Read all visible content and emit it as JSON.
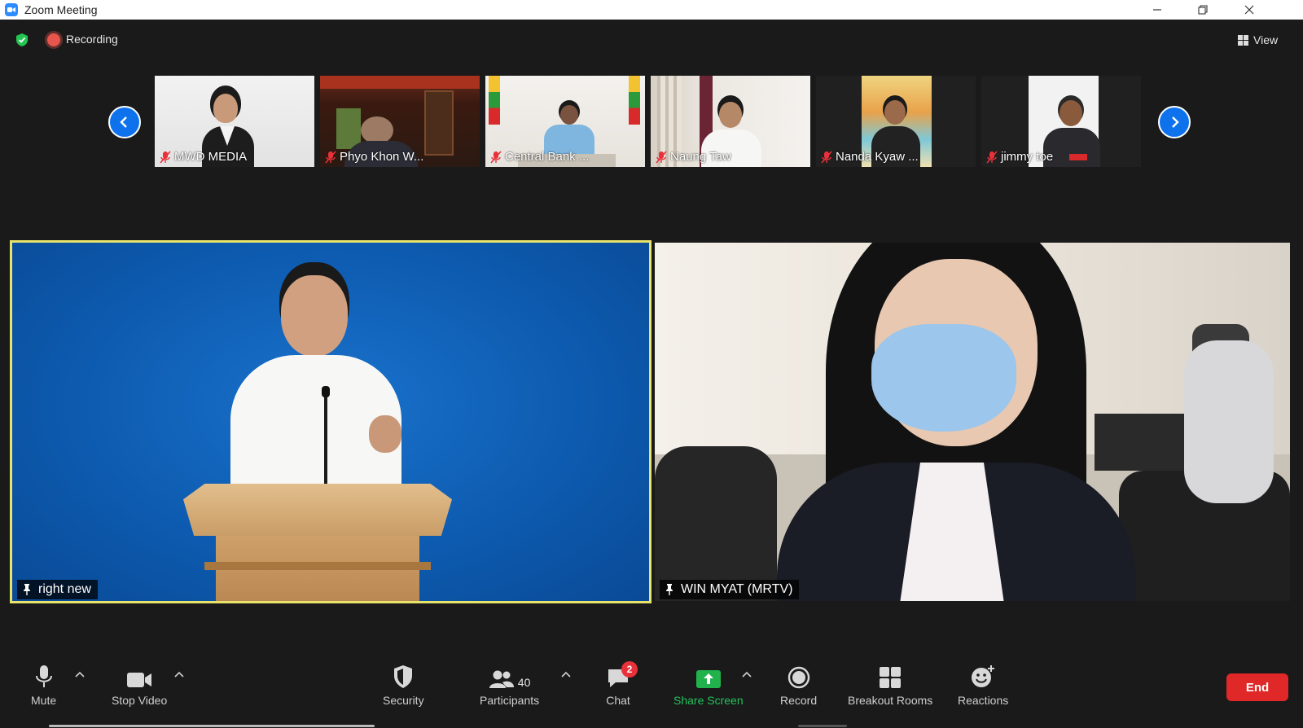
{
  "window": {
    "title": "Zoom Meeting"
  },
  "top_bar": {
    "recording_label": "Recording",
    "view_label": "View"
  },
  "thumbnails": [
    {
      "name": "MWD MEDIA",
      "muted": true
    },
    {
      "name": "Phyo Khon W...",
      "muted": true
    },
    {
      "name": "Central Bank ...",
      "muted": true
    },
    {
      "name": "Naung Taw",
      "muted": true
    },
    {
      "name": "Nanda Kyaw ...",
      "muted": true
    },
    {
      "name": "jimmy toe",
      "muted": true
    }
  ],
  "main_tiles": [
    {
      "name": "right new",
      "pinned": true,
      "active_speaker": true
    },
    {
      "name": "WIN MYAT (MRTV)",
      "pinned": true,
      "active_speaker": false
    }
  ],
  "toolbar": {
    "mute_label": "Mute",
    "stop_video_label": "Stop Video",
    "security_label": "Security",
    "participants_label": "Participants",
    "participants_count": "40",
    "chat_label": "Chat",
    "chat_badge": "2",
    "share_screen_label": "Share Screen",
    "record_label": "Record",
    "breakout_rooms_label": "Breakout Rooms",
    "reactions_label": "Reactions",
    "end_label": "End"
  },
  "colors": {
    "accent_blue": "#0e72ed",
    "share_green": "#22b24c",
    "end_red": "#e02828",
    "speaker_border": "#e8e36a",
    "recording_red": "#e8554d"
  }
}
